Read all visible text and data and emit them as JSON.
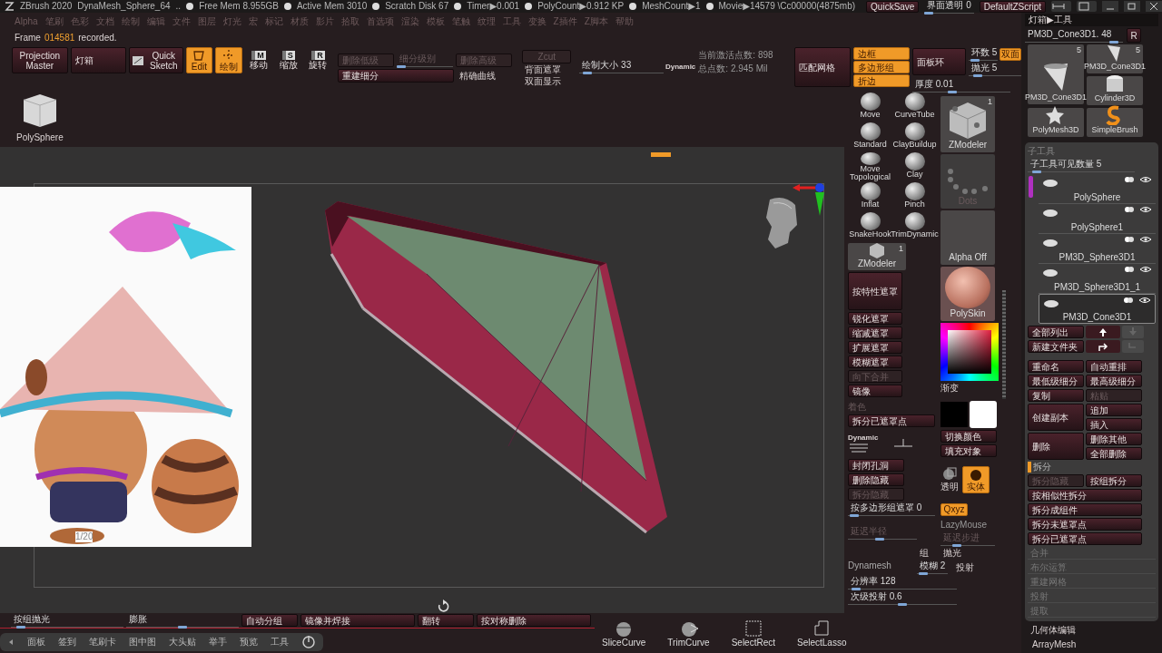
{
  "title_bar": {
    "app": "ZBrush 2020",
    "document": "DynaMesh_Sphere_64",
    "ellipsis": "..",
    "stats": [
      "Free Mem 8.955GB",
      "Active Mem 3010",
      "Scratch Disk 67",
      "Timer▶0.001",
      "PolyCount▶0.912 KP",
      "MeshCount▶1",
      "Movie▶14579 \\Cc00000(4875mb)"
    ],
    "quicksave": "QuickSave",
    "transparency": {
      "label": "界面透明 0",
      "level": 0.0
    },
    "script": "DefaultZScript"
  },
  "menu": [
    "Alpha",
    "笔刷",
    "色彩",
    "文档",
    "绘制",
    "编辑",
    "文件",
    "图层",
    "灯光",
    "宏",
    "标记",
    "材质",
    "影片",
    "拾取",
    "首选项",
    "渲染",
    "模板",
    "笔触",
    "纹理",
    "工具",
    "变换",
    "Z插件",
    "Z脚本",
    "帮助"
  ],
  "record": {
    "prefix": "Frame",
    "frame": "014581",
    "suffix": "recorded."
  },
  "shelf": {
    "projection_master": "Projection Master",
    "lightbox": "灯箱",
    "quick_sketch": "Quick Sketch",
    "modes": [
      {
        "label": "Edit",
        "kind": "edit",
        "selected": true
      },
      {
        "label": "绘制",
        "kind": "draw",
        "selected": true
      },
      {
        "label": "移动",
        "kind": "key",
        "key": "M",
        "selected": false
      },
      {
        "label": "缩放",
        "kind": "key",
        "key": "S",
        "selected": false
      },
      {
        "label": "旋转",
        "kind": "key",
        "key": "R",
        "selected": false
      }
    ],
    "subdivision": {
      "lower": {
        "label": "删除低级",
        "disabled": true
      },
      "level": {
        "label": "细分级别",
        "level": 0.0
      },
      "higher": {
        "label": "删除高级",
        "disabled": true
      },
      "zcut": {
        "label": "Zcut",
        "disabled": true
      },
      "rebuild": "重建细分",
      "smooth": "精确曲线",
      "backface": "背面遮罩",
      "double": "双面显示"
    },
    "draw_size": {
      "label": "绘制大小 33",
      "level": 0.05
    },
    "dynamic": "Dynamic",
    "points": [
      "当前激活点数: 898",
      "总点数: 2.945 Mil"
    ],
    "match_mesh": "匹配网格",
    "edge_toggles": [
      {
        "label": "边框",
        "on": true
      },
      {
        "label": "多边形组",
        "on": true
      },
      {
        "label": "折边",
        "on": true
      }
    ],
    "panel_loops": "面板环",
    "loops": {
      "label": "环数 5",
      "level": 0.1
    },
    "double_sided": {
      "label": "双面",
      "on": true
    },
    "polish": {
      "label": "抛光 5",
      "level": 0.1
    },
    "thickness": {
      "label": "厚度 0.01",
      "level": 0.4
    }
  },
  "tool_thumb": "PolySphere",
  "reference": {
    "kind": "picture",
    "counter": "1/20"
  },
  "tool_palette": {
    "brushes": [
      "Move",
      "CurveTube",
      "Standard",
      "ClayBuildup",
      "Move Topological",
      "Clay",
      "Inflat",
      "Pinch",
      "SnakeHook",
      "TrimDynamic"
    ],
    "current_brush": {
      "label": "ZModeler",
      "count": "1"
    },
    "stroke": "Dots",
    "alpha": "Alpha Off",
    "brush_small": {
      "label": "ZModeler",
      "count": "1"
    },
    "material": "PolySkin",
    "mask_by_feature": "按特性遮罩",
    "mask_ops": [
      {
        "label": "锐化遮罩",
        "disabled": false
      },
      {
        "label": "缩减遮罩",
        "disabled": false
      },
      {
        "label": "扩展遮罩",
        "disabled": false
      },
      {
        "label": "模糊遮罩",
        "disabled": false
      },
      {
        "label": "向下合并",
        "disabled": true
      },
      {
        "label": "镜像",
        "disabled": false
      }
    ],
    "gradient": "渐变",
    "shade": "着色",
    "split_masked": "拆分已遮罩点",
    "dynamic_tag": "Dynamic",
    "switch_color": "切换颜色",
    "fill_object": "填充对象",
    "mesh_ops": [
      {
        "label": "封闭孔洞",
        "disabled": false
      },
      {
        "label": "删除隐藏",
        "disabled": false
      },
      {
        "label": "拆分隐藏",
        "disabled": true
      }
    ],
    "transparent": "透明",
    "solid": {
      "label": "实体",
      "on": true
    },
    "qxyz": {
      "label": "Qxyz",
      "on": true
    },
    "polygroup_mask": {
      "label": "按多边形组遮罩 0",
      "level": 0.02
    },
    "lazymouse": {
      "title": "LazyMouse",
      "radius": {
        "label": "延迟半径",
        "level": 0.45
      },
      "step": {
        "label": "延迟步进",
        "level": 0.25
      }
    },
    "dynamesh": {
      "title": "Dynamesh",
      "group": "组",
      "polish": "抛光",
      "blur": {
        "label": "模糊 2",
        "level": 0.1
      },
      "project": "投射",
      "resolution": {
        "label": "分辨率 128",
        "level": 0.04
      },
      "sub_project": {
        "label": "次级投射 0.6",
        "level": 0.5
      }
    }
  },
  "bottom_shelf": [
    {
      "label": "按组抛光",
      "kind": "slider",
      "level": 0.05
    },
    {
      "label": "膨胀",
      "kind": "slider",
      "level": 0.5
    },
    {
      "label": "自动分组",
      "kind": "button"
    },
    {
      "label": "镜像并焊接",
      "kind": "button"
    },
    {
      "label": "翻转",
      "kind": "button"
    },
    {
      "label": "按对称删除",
      "kind": "button"
    }
  ],
  "dock": [
    "面板",
    "签到",
    "笔刷卡",
    "图中图",
    "大头贴",
    "举手",
    "预览",
    "工具"
  ],
  "curve_tools": [
    {
      "label": "SliceCurve",
      "kind": "slice"
    },
    {
      "label": "TrimCurve",
      "kind": "trim"
    },
    {
      "label": "SelectRect",
      "kind": "rect"
    },
    {
      "label": "SelectLasso",
      "kind": "lasso"
    }
  ],
  "right_panel": {
    "path": "灯箱▶工具",
    "current_tool": {
      "label": "PM3D_Cone3D1. 48",
      "level": 0.95
    },
    "r_button": "R",
    "tools": [
      {
        "label": "PM3D_Cone3D1",
        "count": "5",
        "kind": "big-cone"
      },
      {
        "label": "PM3D_Cone3D1",
        "count": "5",
        "kind": "cone"
      },
      {
        "label": "Cylinder3D",
        "kind": "cylinder"
      },
      {
        "label": "PolyMesh3D",
        "kind": "star"
      },
      {
        "label": "SimpleBrush",
        "kind": "brush"
      }
    ],
    "subtool": {
      "title": "子工具",
      "visible": {
        "label": "子工具可见数量 5",
        "level": 0.05
      },
      "items": [
        {
          "name": "PolySphere",
          "selected": false
        },
        {
          "name": "PolySphere1",
          "selected": false
        },
        {
          "name": "PM3D_Sphere3D1",
          "selected": false
        },
        {
          "name": "PM3D_Sphere3D1_1",
          "selected": false
        },
        {
          "name": "PM3D_Cone3D1",
          "selected": true
        }
      ],
      "list_all": "全部列出",
      "new_folder": "新建文件夹",
      "pairs": [
        [
          {
            "label": "重命名",
            "disabled": false
          },
          {
            "label": "自动重排",
            "disabled": false
          }
        ],
        [
          {
            "label": "最低级细分",
            "disabled": false
          },
          {
            "label": "最高级细分",
            "disabled": false
          }
        ],
        [
          {
            "label": "复制",
            "disabled": false
          },
          {
            "label": "粘贴",
            "disabled": true
          }
        ]
      ],
      "duplicate": {
        "label": "创建副本",
        "items": [
          "追加",
          "插入"
        ]
      },
      "delete": {
        "label": "删除",
        "items": [
          "删除其他",
          "全部删除"
        ]
      },
      "split_title": "拆分",
      "split": [
        {
          "label": "拆分隐藏",
          "disabled": true
        },
        {
          "label": "按组拆分",
          "disabled": false
        },
        {
          "label": "按相似性拆分",
          "disabled": false
        },
        {
          "label": "拆分成组件",
          "disabled": false
        },
        {
          "label": "拆分未遮罩点",
          "disabled": false
        },
        {
          "label": "拆分已遮罩点",
          "disabled": false
        }
      ],
      "sections": [
        "合并",
        "布尔运算",
        "重建网格",
        "投射",
        "提取"
      ]
    },
    "geometry": "几何体编辑",
    "array_mesh": "ArrayMesh"
  }
}
